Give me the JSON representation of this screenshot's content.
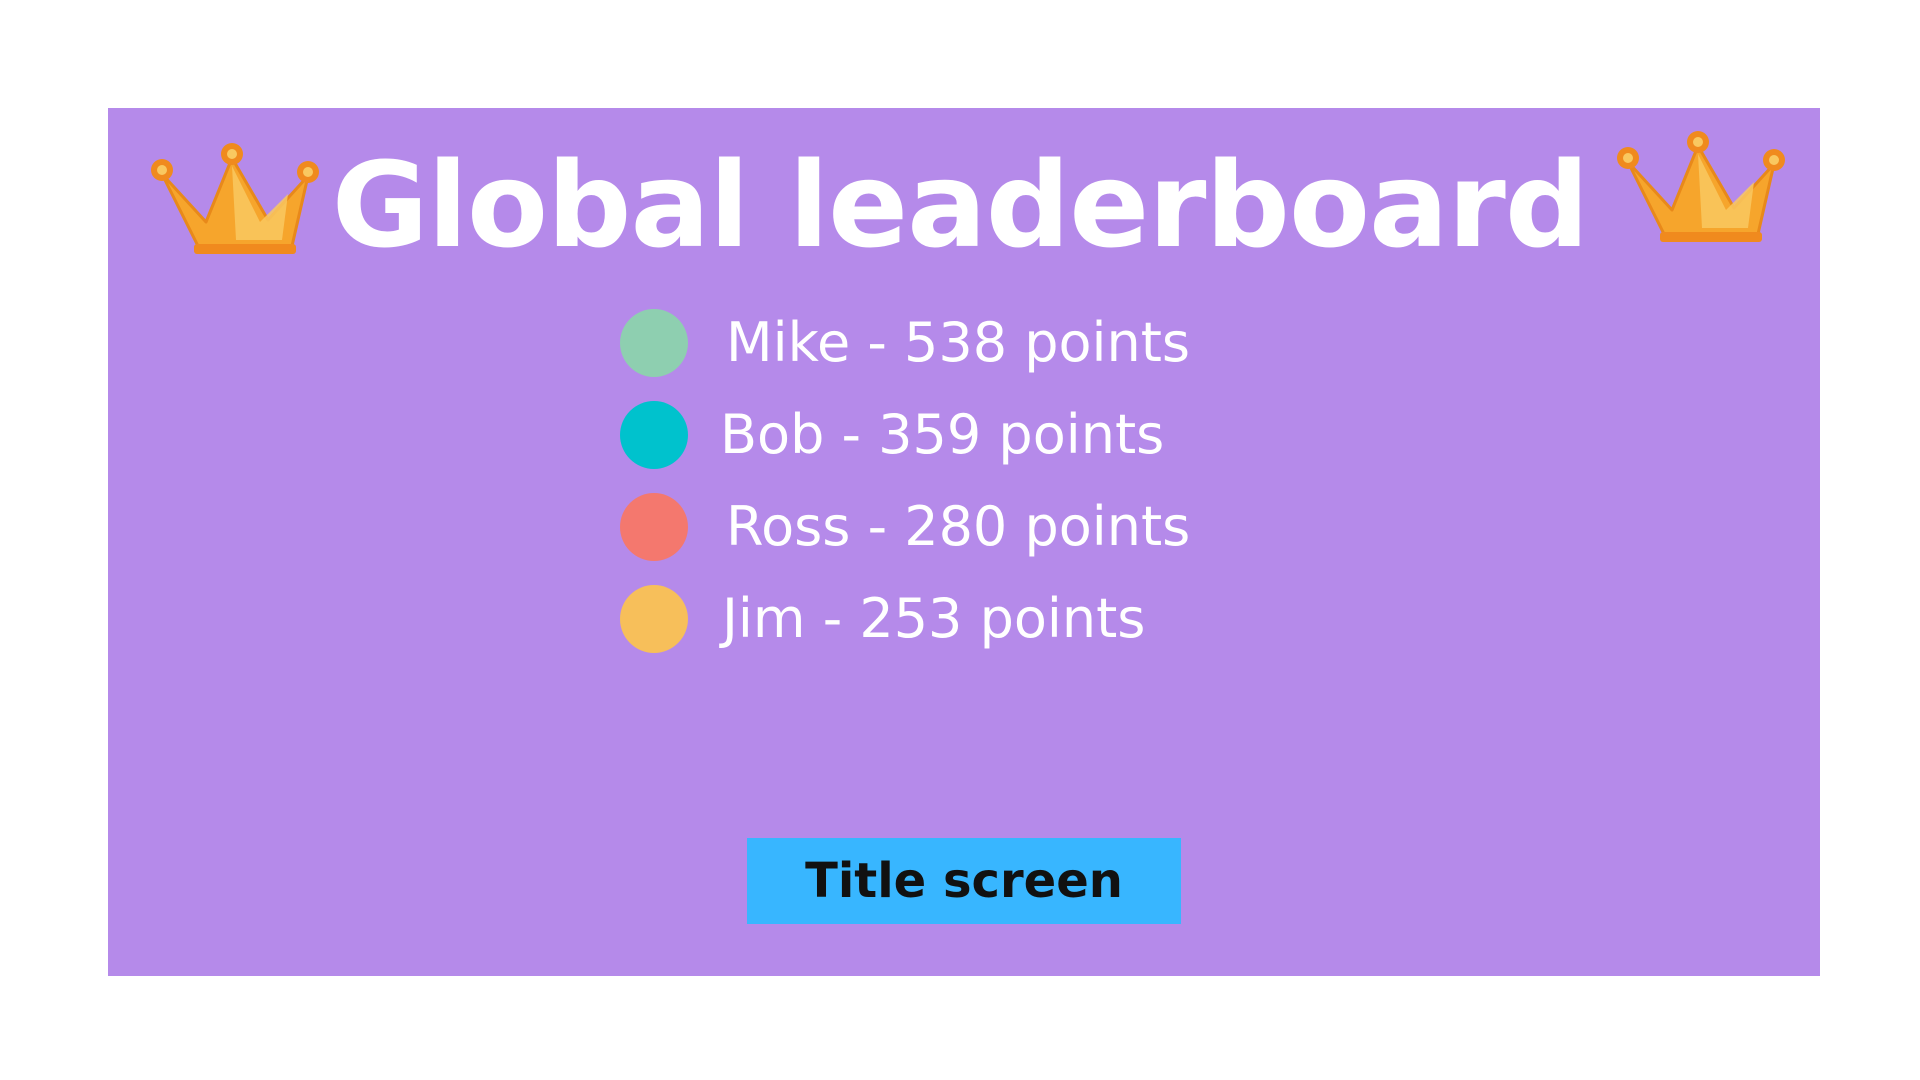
{
  "title": "Global leaderboard",
  "entries": [
    {
      "text": "Mike - 538 points",
      "color": "#8ecfb0"
    },
    {
      "text": "Bob - 359 points",
      "color": "#00c2cd"
    },
    {
      "text": "Ross - 280 points",
      "color": "#f4786e"
    },
    {
      "text": "Jim - 253 points",
      "color": "#f7bf5a"
    }
  ],
  "button": {
    "label": "Title screen"
  },
  "icons": {
    "crown": "crown-icon"
  },
  "colors": {
    "panel": "#b58aea",
    "button": "#38b6ff",
    "crown": "#f6a52c"
  }
}
